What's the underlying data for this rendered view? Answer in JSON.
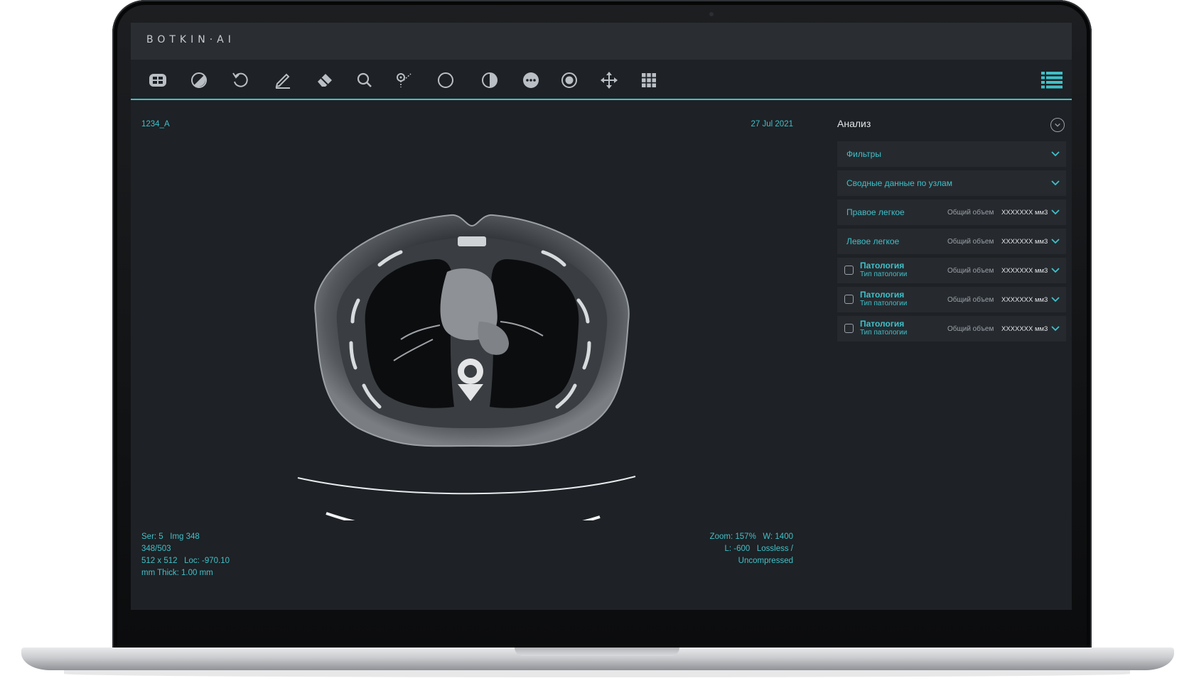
{
  "app": {
    "brand": "BOTKIN·AI"
  },
  "toolbar": {
    "tools": [
      {
        "icon": "layout-grid-icon"
      },
      {
        "icon": "window-level-icon"
      },
      {
        "icon": "rotate-icon"
      },
      {
        "icon": "pencil-icon"
      },
      {
        "icon": "eraser-icon"
      },
      {
        "icon": "magnifier-icon"
      },
      {
        "icon": "probe-icon"
      },
      {
        "icon": "ellipse-icon"
      },
      {
        "icon": "contrast-icon"
      },
      {
        "icon": "more-icon"
      },
      {
        "icon": "target-icon"
      },
      {
        "icon": "pan-icon"
      },
      {
        "icon": "grid-icon"
      }
    ],
    "menu_icon": "list-menu-icon"
  },
  "viewer": {
    "study_id": "1234_A",
    "date": "27 Jul 2021",
    "bottom_left": [
      "Ser: 5   Img 348",
      "348/503",
      "512 x 512   Loc: -970.10",
      "mm Thick: 1.00 mm"
    ],
    "bottom_right": [
      "Zoom: 157%   W: 1400",
      "L: -600   Lossless /",
      "Uncompressed"
    ]
  },
  "panel": {
    "title": "Анализ",
    "rows": [
      {
        "label": "Фильтры"
      },
      {
        "label": "Сводные данные по узлам"
      },
      {
        "label": "Правое легкое",
        "volume_label": "Общий объем",
        "volume_value": "XXXXXXX мм3"
      },
      {
        "label": "Левое легкое",
        "volume_label": "Общий объем",
        "volume_value": "XXXXXXX мм3"
      }
    ],
    "pathologies": [
      {
        "name": "Патология",
        "type": "Тип патологии",
        "volume_label": "Общий объем",
        "volume_value": "XXXXXXX мм3"
      },
      {
        "name": "Патология",
        "type": "Тип патологии",
        "volume_label": "Общий объем",
        "volume_value": "XXXXXXX мм3"
      },
      {
        "name": "Патология",
        "type": "Тип патологии",
        "volume_label": "Общий объем",
        "volume_value": "XXXXXXX мм3"
      }
    ]
  },
  "colors": {
    "accent": "#3fc1c9",
    "background": "#1e2125",
    "panel_row": "#262a2f",
    "titlebar": "#2a2e33"
  }
}
